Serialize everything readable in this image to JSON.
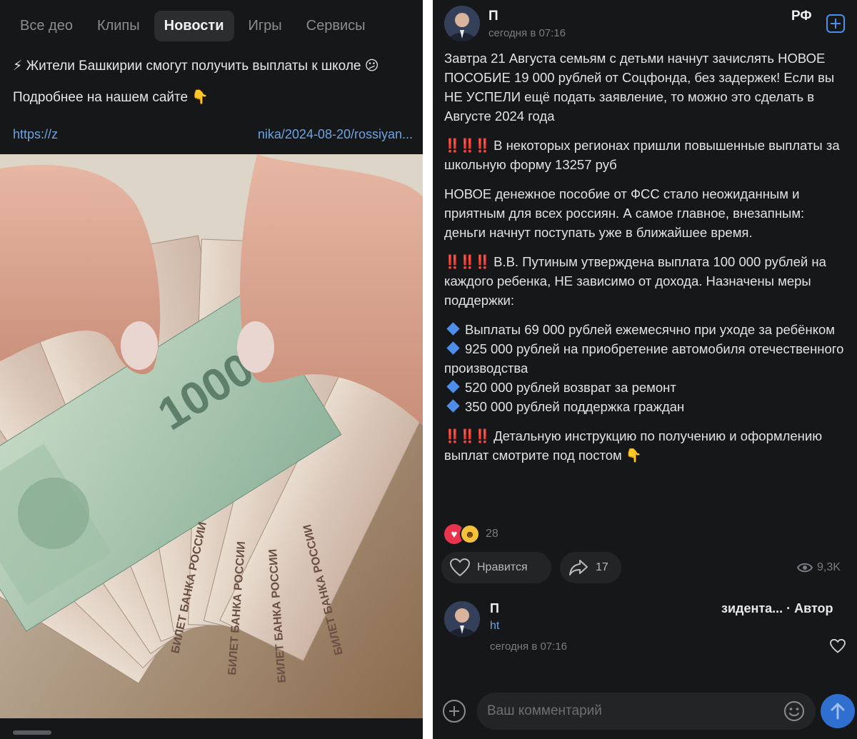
{
  "left_panel": {
    "tabs": [
      {
        "label": "Все   део",
        "active": false
      },
      {
        "label": "Клипы",
        "active": false
      },
      {
        "label": "Новости",
        "active": true
      },
      {
        "label": "Игры",
        "active": false
      },
      {
        "label": "Сервисы",
        "active": false
      }
    ],
    "post": {
      "headline": "⚡ Жители Башкирии смогут получить выплаты к школе 😕",
      "more": "Подробнее на нашем сайте 👇",
      "link_start": "https://z",
      "link_end": "nika/2024-08-20/rossiyan..."
    },
    "photo_note": "photo of ruble banknotes",
    "banknote_text": [
      "БИЛЕТ БАНКА РОССИИ",
      "1000"
    ]
  },
  "right_panel": {
    "header": {
      "author": "П",
      "time": "сегодня в 07:16",
      "rf": "РФ"
    },
    "body": {
      "p1": "Завтра 21 Августа семьям с детьми начнут зачислять НОВОЕ ПОСОБИЕ 19 000 рублей от Соцфонда, без задержек! Если вы НЕ УСПЕЛИ ещё подать заявление, то можно это сделать в Августе 2024 года",
      "bang": "‼️‼️‼️",
      "p2": "В некоторых регионах пришли повышенные выплаты за школьную форму 13257 руб",
      "p3": "НОВОЕ денежное пособие от ФСС стало неожиданным и приятным для всех россиян. А самое главное, внезапным: деньги начнут поступать уже в ближайшее время.",
      "p4": "В.В. Путиным утверждена выплата 100 000 рублей на каждого ребенка, НЕ зависимо от дохода. Назначены меры поддержки:",
      "bullets": [
        "Выплаты 69 000 рублей ежемесячно при уходе за ребёнком",
        "925 000 рублей на приобретение автомобиля отечественного производства",
        "520 000 рублей возврат за ремонт",
        "350 000 рублей поддержка граждан"
      ],
      "p5": "Детальную инструкцию по получению и оформлению выплат смотрите под постом 👇"
    },
    "reactions": {
      "count": "28"
    },
    "actions": {
      "like_label": "Нравится",
      "share_count": "17",
      "views": "9,3K"
    },
    "comment": {
      "author": "П",
      "meta": "зидента... · Автор",
      "text": "ht",
      "time": "сегодня в 07:16"
    },
    "composer": {
      "placeholder": "Ваш комментарий"
    },
    "colors": {
      "accent": "#2e6fd0",
      "link": "#6fa3e0",
      "alert": "#e0323a",
      "background": "#161718"
    }
  }
}
